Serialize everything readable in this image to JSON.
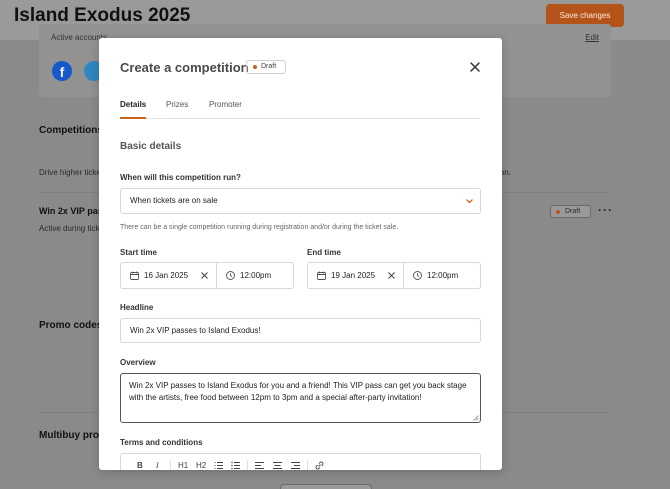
{
  "page": {
    "title": "Island Exodus 2025",
    "save_button": "Save changes",
    "active_section_label": "Active accounts",
    "active_section_link": "Edit",
    "competitions_heading": "Competitions",
    "competitions_desc_left": "Drive higher ticke",
    "competitions_desc_right": "ition.",
    "competition_row_title": "Win 2x VIP pas",
    "competition_row_sub": "Active during tick",
    "competition_row_badge": "Draft",
    "promo_heading": "Promo codes",
    "multibuy_heading": "Multibuy prom"
  },
  "modal": {
    "title": "Create a competition",
    "status_badge": "Draft",
    "tabs": [
      {
        "label": "Details",
        "active": true
      },
      {
        "label": "Prizes",
        "active": false
      },
      {
        "label": "Promoter",
        "active": false
      }
    ],
    "section_title": "Basic details",
    "when_label": "When will this competition run?",
    "when_value": "When tickets are on sale",
    "when_helper": "There can be a single competition running during registration and/or during the ticket sale.",
    "start_label": "Start time",
    "start_date": "16 Jan 2025",
    "start_time": "12:00pm",
    "end_label": "End time",
    "end_date": "19 Jan 2025",
    "end_time": "12:00pm",
    "headline_label": "Headline",
    "headline_value": "Win 2x VIP passes to Island Exodus!",
    "overview_label": "Overview",
    "overview_value": "Win 2x VIP passes to Island Exodus for you and a friend! This VIP pass can get you back stage with the artists, free food between 12pm to 3pm and a special after-party invitation!",
    "terms_label": "Terms and conditions",
    "toolbar": {
      "bold": "B",
      "italic": "I",
      "h1": "H1",
      "h2": "H2"
    }
  },
  "colors": {
    "accent": "#c8621d",
    "save_button_bg": "#b5541a",
    "facebook": "#1657c9"
  }
}
